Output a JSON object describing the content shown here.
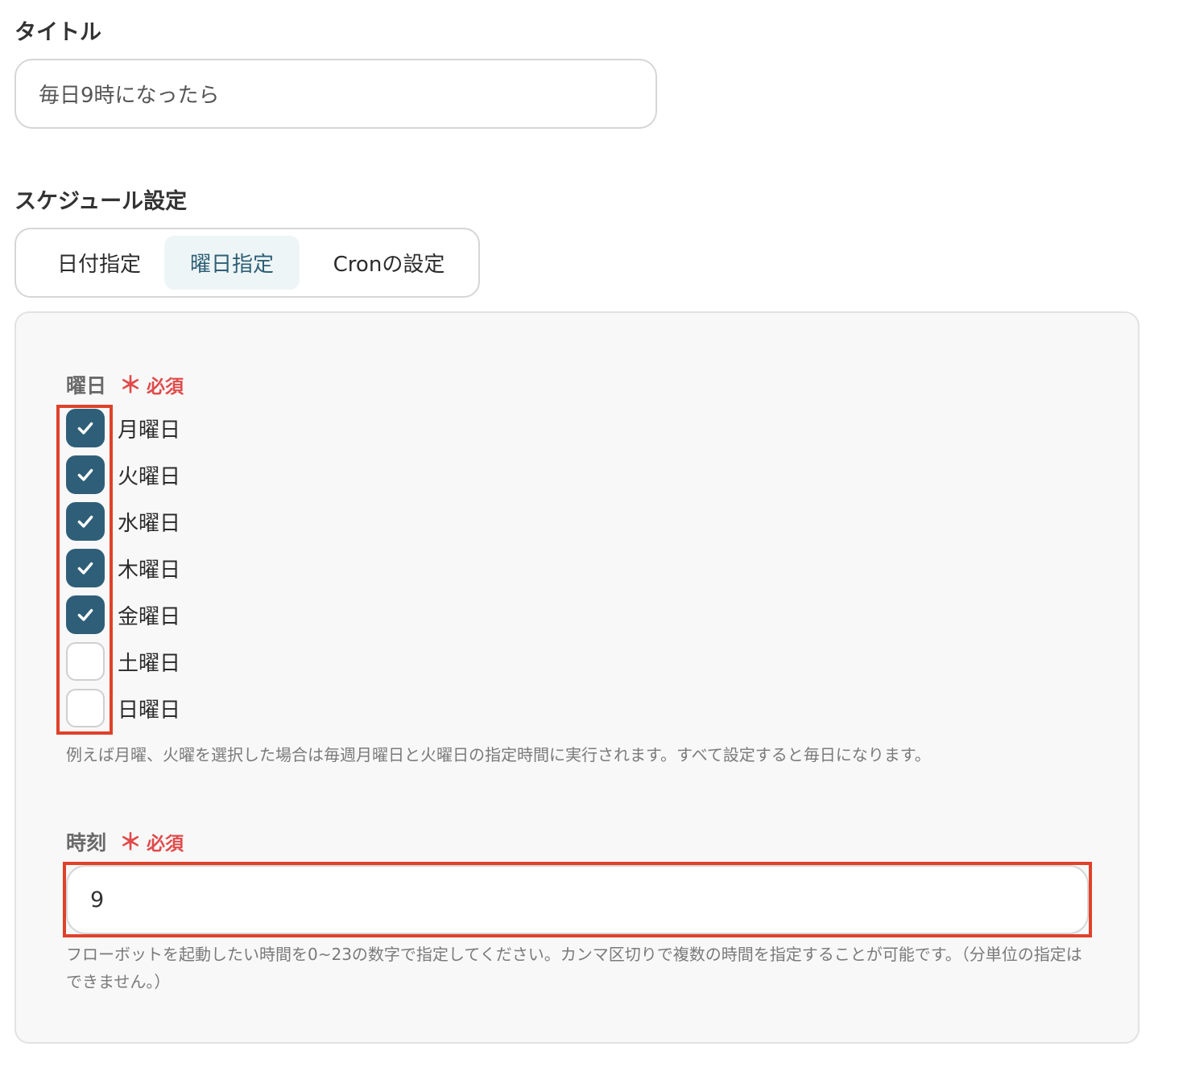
{
  "title_field": {
    "label": "タイトル",
    "value": "毎日9時になったら"
  },
  "schedule": {
    "label": "スケジュール設定",
    "tabs": [
      {
        "label": "日付指定",
        "selected": false
      },
      {
        "label": "曜日指定",
        "selected": true
      },
      {
        "label": "Cronの設定",
        "selected": false
      }
    ]
  },
  "weekday_field": {
    "label": "曜日",
    "required_mark": "＊",
    "required_text": "必須",
    "days": [
      {
        "label": "月曜日",
        "checked": true
      },
      {
        "label": "火曜日",
        "checked": true
      },
      {
        "label": "水曜日",
        "checked": true
      },
      {
        "label": "木曜日",
        "checked": true
      },
      {
        "label": "金曜日",
        "checked": true
      },
      {
        "label": "土曜日",
        "checked": false
      },
      {
        "label": "日曜日",
        "checked": false
      }
    ],
    "help": "例えば月曜、火曜を選択した場合は毎週月曜日と火曜日の指定時間に実行されます。すべて設定すると毎日になります。"
  },
  "time_field": {
    "label": "時刻",
    "required_mark": "＊",
    "required_text": "必須",
    "value": "9",
    "help": "フローボットを起動したい時間を0~23の数字で指定してください。カンマ区切りで複数の時間を指定することが可能です。（分単位の指定はできません。）"
  },
  "colors": {
    "accent": "#2f5f78",
    "tab_selected_bg": "#eef5f7",
    "required": "#e04b4b",
    "highlight": "#e0412a"
  },
  "icons": {
    "checked": "checkmark-icon"
  }
}
